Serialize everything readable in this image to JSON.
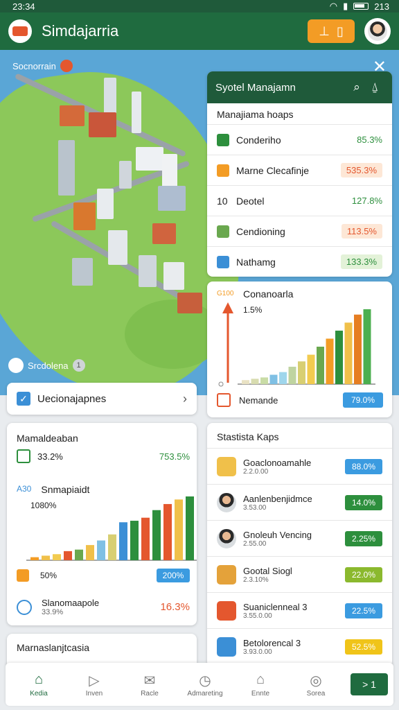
{
  "statusbar": {
    "time": "23:34",
    "battery": "213"
  },
  "app": {
    "title": "Simdajarria"
  },
  "map": {
    "label": "Socnorrain",
    "footer": "Srcdolena",
    "footer_count": "1"
  },
  "system_panel": {
    "title": "Syotel Manajamn",
    "subtitle": "Manajiama hoaps",
    "rows": [
      {
        "label": "Conderiho",
        "value": "85.3%",
        "icon_color": "#2d8f3d",
        "chip_bg": "",
        "value_color": "#2d8f3d"
      },
      {
        "label": "Marne Clecafinje",
        "value": "535.3%",
        "icon_color": "#f39c25",
        "chip_bg": "#fde7d6",
        "value_color": "#e4572e"
      },
      {
        "label": "Deotel",
        "prefix": "10",
        "value": "127.8%",
        "icon_color": "",
        "chip_bg": "",
        "value_color": "#2d8f3d"
      },
      {
        "label": "Cendioning",
        "value": "113.5%",
        "icon_color": "#6aa84f",
        "chip_bg": "#fde7d6",
        "value_color": "#e4572e"
      },
      {
        "label": "Nathamg",
        "value": "133.3%",
        "icon_color": "#3b8fd6",
        "chip_bg": "#e3f2d8",
        "value_color": "#2d8f3d"
      }
    ]
  },
  "growth_chart": {
    "tag": "G100",
    "title": "Conanoarla",
    "value": "1.5%",
    "footer_label": "Nemande",
    "footer_value": "79.0%"
  },
  "chart_data": [
    {
      "type": "bar",
      "values": [
        3,
        4,
        5,
        7,
        9,
        13,
        17,
        22,
        28,
        34,
        40,
        46,
        52,
        56
      ],
      "colors": [
        "#e9e2c4",
        "#d8dcb0",
        "#c9dca6",
        "#7fc0e4",
        "#9fd6ec",
        "#bfd4a0",
        "#d8cf72",
        "#f2cb50",
        "#6aa84f",
        "#f39c25",
        "#2d8f3d",
        "#f0c04a",
        "#e67e22",
        "#4caf50"
      ]
    },
    {
      "type": "bar",
      "values": [
        2,
        3,
        4,
        6,
        7,
        10,
        13,
        17,
        25,
        26,
        28,
        33,
        37,
        40,
        42
      ],
      "colors": [
        "#f39c25",
        "#f0c04a",
        "#f2cb50",
        "#e4572e",
        "#6aa84f",
        "#f0c04a",
        "#7fc0e4",
        "#d8cf72",
        "#3b8fd6",
        "#2d8f3d",
        "#e4572e",
        "#2d8f3d",
        "#e4572e",
        "#f0c04a",
        "#2d8f3d"
      ]
    }
  ],
  "decision_card": {
    "label": "Uecionajapnes"
  },
  "management_card": {
    "title": "Mamaldeaban",
    "value1": "33.2%",
    "value1_pct": "753.5%",
    "chart_tag": "A30",
    "chart_title": "Snmapiaidt",
    "chart_value": "1080%",
    "row2_label": "50%",
    "row2_value": "200%",
    "row3_title": "Slanomaapole",
    "row3_sub": "33.9%",
    "row3_pct": "16.3%"
  },
  "statistics": {
    "title": "Stastista Kaps",
    "rows": [
      {
        "title": "Goaclonoamahle",
        "sub": "2.2.0.00",
        "value": "88.0%",
        "icon": "#f0c04a",
        "pill": "#3b9be0",
        "person": false
      },
      {
        "title": "Aanlenbenjidmce",
        "sub": "3.53.00",
        "value": "14.0%",
        "icon": "",
        "pill": "#2d8f3d",
        "person": true
      },
      {
        "title": "Gnoleuh Vencing",
        "sub": "2.55.00",
        "value": "2.25%",
        "icon": "",
        "pill": "#2d8f3d",
        "person": true
      },
      {
        "title": "Gootal Siogl",
        "sub": "2.3.10%",
        "value": "22.0%",
        "icon": "#e4a23a",
        "pill": "#8bb92e",
        "person": false
      },
      {
        "title": "Suaniclenneal 3",
        "sub": "3.55.0.00",
        "value": "22.5%",
        "icon": "#e4572e",
        "pill": "#3b9be0",
        "person": false
      },
      {
        "title": "Betolorencal 3",
        "sub": "3.93.0.00",
        "value": "52.5%",
        "icon": "#3b8fd6",
        "pill": "#f0c419",
        "person": false
      }
    ]
  },
  "bottom_card": {
    "title": "Marnaslanjtcasia"
  },
  "nav": [
    {
      "label": "Kedia",
      "icon": "home-icon",
      "glyph": "⌂",
      "active": true
    },
    {
      "label": "Inven",
      "icon": "play-icon",
      "glyph": "▷",
      "active": false
    },
    {
      "label": "Racle",
      "icon": "mail-icon",
      "glyph": "✉",
      "active": false
    },
    {
      "label": "Admareting",
      "icon": "timer-icon",
      "glyph": "◷",
      "active": false
    },
    {
      "label": "Ennte",
      "icon": "building-icon",
      "glyph": "⌂",
      "active": false
    },
    {
      "label": "Sorea",
      "icon": "globe-icon",
      "glyph": "◎",
      "active": false
    }
  ],
  "nav_go": "> 1"
}
